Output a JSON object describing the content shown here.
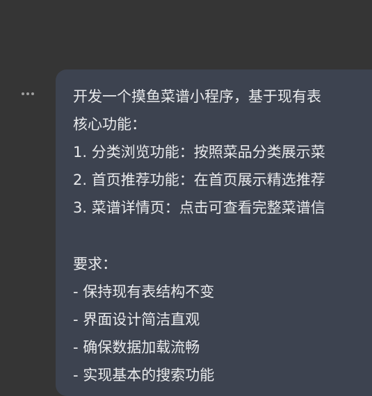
{
  "message": {
    "more_icon": "more-horizontal-icon",
    "lines": [
      "开发一个摸鱼菜谱小程序，基于现有表",
      "核心功能：",
      "1. 分类浏览功能：按照菜品分类展示菜",
      "2. 首页推荐功能：在首页展示精选推荐",
      "3. 菜谱详情页：点击可查看完整菜谱信",
      "",
      "要求：",
      "- 保持现有表结构不变",
      "- 界面设计简洁直观",
      "- 确保数据加载流畅",
      "- 实现基本的搜索功能"
    ]
  },
  "colors": {
    "background": "#353535",
    "bubble": "#3d4350",
    "text": "#e9eaec"
  }
}
